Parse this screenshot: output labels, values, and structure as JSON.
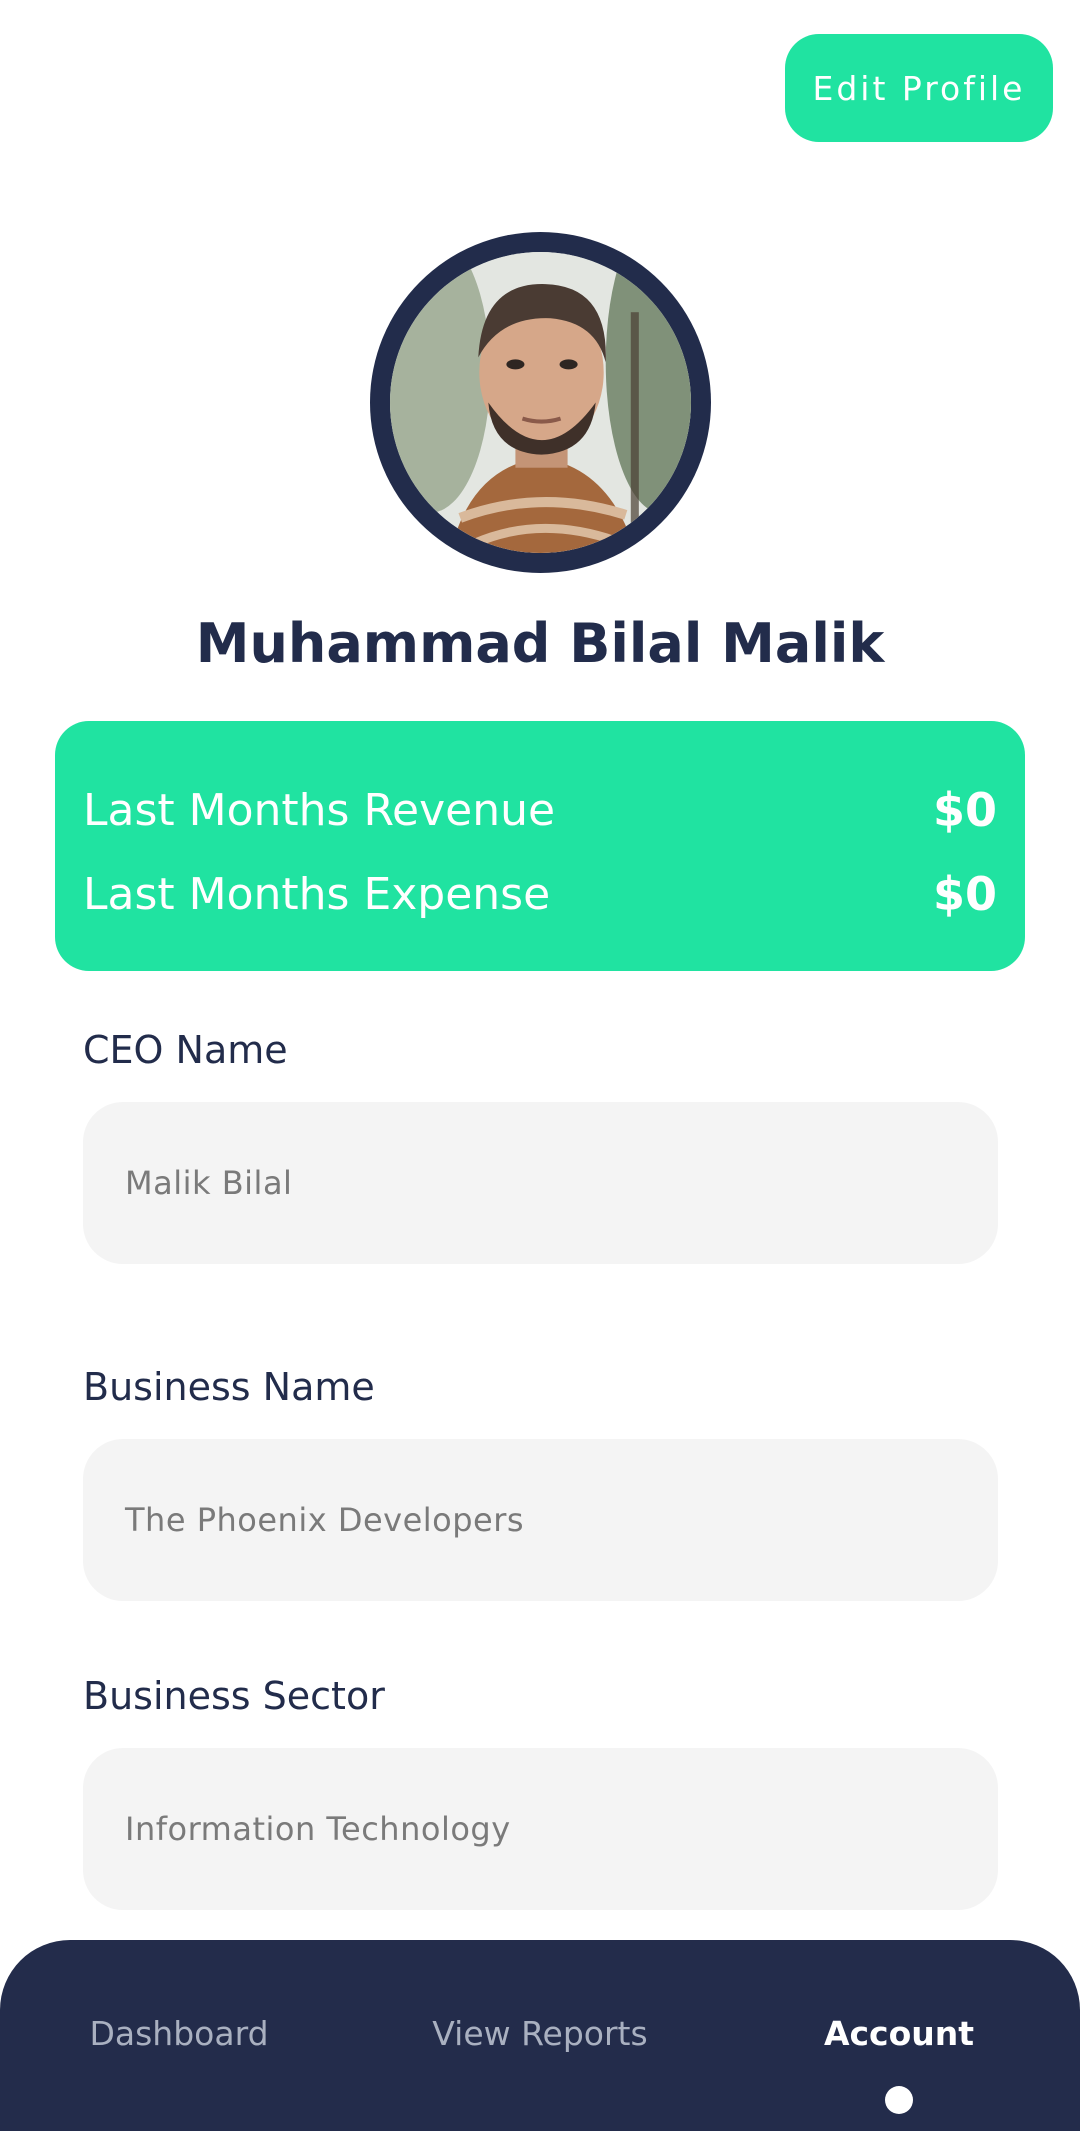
{
  "header": {
    "edit_button_label": "Edit Profile"
  },
  "profile": {
    "name": "Muhammad Bilal Malik",
    "avatar": "user-photo"
  },
  "summary": {
    "revenue_label": "Last Months Revenue",
    "revenue_value": "$0",
    "expense_label": "Last Months Expense",
    "expense_value": "$0"
  },
  "fields": [
    {
      "label": "CEO Name",
      "value": "Malik Bilal"
    },
    {
      "label": "Business Name",
      "value": "The Phoenix Developers"
    },
    {
      "label": "Business Sector",
      "value": "Information Technology"
    }
  ],
  "nav": {
    "items": [
      {
        "label": "Dashboard",
        "active": false
      },
      {
        "label": "View Reports",
        "active": false
      },
      {
        "label": "Account",
        "active": true
      }
    ]
  },
  "colors": {
    "accent": "#20e3a1",
    "navy": "#232c4b",
    "field_bg": "#f4f4f4"
  }
}
